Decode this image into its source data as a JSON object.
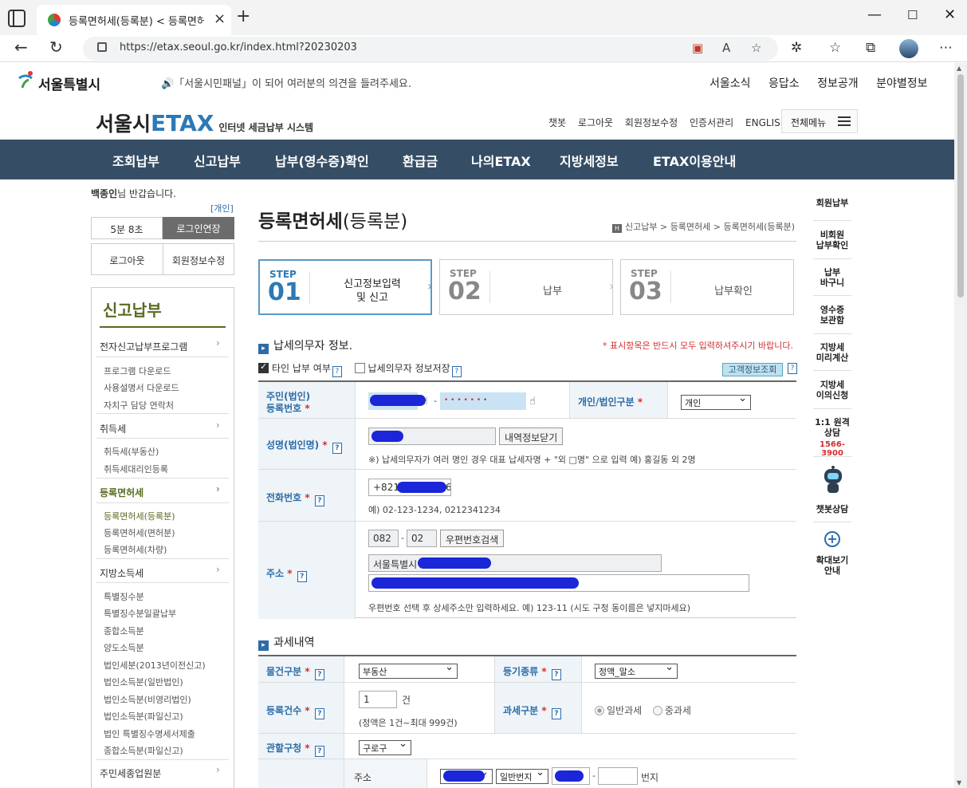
{
  "browser": {
    "tab_title": "등록면허세(등록분) < 등록면허세",
    "url": "https://etax.seoul.go.kr/index.html?20230203"
  },
  "header": {
    "seoul_name": "서울특별시",
    "notice": "🔊「서울시민패널」이 되어 여러분의 의견을 들려주세요.",
    "gnb": [
      "서울소식",
      "응답소",
      "정보공개",
      "분야별정보"
    ],
    "etax_a": "서울시",
    "etax_b": "ETAX",
    "etax_c": "인터넷 세금납부 시스템",
    "util": [
      "챗봇",
      "로그아웃",
      "회원정보수정",
      "인증서관리",
      "ENGLISH"
    ],
    "allmenu": "전체메뉴",
    "mainnav": [
      "조회납부",
      "신고납부",
      "납부(영수증)확인",
      "환급금",
      "나의ETAX",
      "지방세정보",
      "ETAX이용안내"
    ]
  },
  "left": {
    "user_name": "백종인",
    "greeting_suffix": "님 반갑습니다.",
    "user_type": "[개인]",
    "timer": "5분 8초",
    "extend": "로그인연장",
    "logout": "로그아웃",
    "member": "회원정보수정",
    "lnb_title": "신고납부",
    "cat_efile": "전자신고납부프로그램",
    "sub_efile": [
      "프로그램 다운로드",
      "사용설명서 다운로드",
      "자치구 담당 연락처"
    ],
    "cat_acq": "취득세",
    "sub_acq": [
      "취득세(부동산)",
      "취득세대리인등록"
    ],
    "cat_reg": "등록면허세",
    "sub_reg": [
      "등록면허세(등록분)",
      "등록면허세(면허분)",
      "등록면허세(차량)"
    ],
    "cat_local": "지방소득세",
    "sub_local": [
      "특별징수분",
      "특별징수분일괄납부",
      "종합소득분",
      "양도소득분",
      "법인세분(2013년이전신고)",
      "법인소득분(일반법인)",
      "법인소득분(비영리법인)",
      "법인소득분(파일신고)",
      "법인 특별징수명세서제출",
      "종합소득분(파일신고)"
    ],
    "cat_resident": "주민세종업원분"
  },
  "main": {
    "title_bold": "등록면허세",
    "title_rest": "(등록분)",
    "breadcrumb": "신고납부 > 등록면허세 > 등록면허세(등록분)",
    "steps": [
      {
        "lbl": "STEP",
        "num": "01",
        "text1": "신고정보입력",
        "text2": "및 신고"
      },
      {
        "lbl": "STEP",
        "num": "02",
        "text1": "납부"
      },
      {
        "lbl": "STEP",
        "num": "03",
        "text1": "납부확인"
      }
    ],
    "section1": "납세의무자 정보.",
    "req_note": "* 표시항목은 반드시 모두 입력하셔주시기 바랍니다.",
    "chk_other": "타인 납부 여부",
    "chk_save": "납세의무자 정보저장",
    "cust_btn": "고객정보조회",
    "rrn_label1": "주민(법인)",
    "rrn_label2": "등록번호",
    "rrn_dash": "-",
    "rrn_masked": "• • • • • • •",
    "type_label": "개인/법인구분",
    "type_value": "개인",
    "name_label": "성명(법인명)",
    "name_btn": "내역정보닫기",
    "name_hint": "※) 납세의무자가 여러 명인 경우 대표 납세자명 + \"외 □명\" 으로 입력 예) 홍길동 외 2명",
    "phone_label": "전화번호",
    "phone_prefix": "+821",
    "phone_suffix": "6",
    "phone_hint": "예) 02-123-1234, 0212341234",
    "addr_label": "주소",
    "zip1": "082",
    "zip_dash": "-",
    "zip2": "02",
    "zip_btn": "우편번호검색",
    "addr1_prefix": "서울특별시",
    "addr_hint": "우편번호 선택 후 상세주소만 입력하세요. 예) 123-11 (시도 구청 동이름은 넣지마세요)",
    "section2": "과세내역",
    "obj_label": "물건구분",
    "obj_value": "부동산",
    "reg_kind_label": "등기종류",
    "reg_kind_value": "정액_말소",
    "count_label": "등록건수",
    "count_value": "1",
    "count_unit": "건",
    "count_hint": "(정액은 1건~최대 999건)",
    "tax_type_label": "과세구분",
    "tax_general": "일반과세",
    "tax_heavy": "중과세",
    "office_label": "관할구청",
    "office_value": "구로구",
    "addr2_label": "주소",
    "lot_type": "일반번지",
    "lot_dash": "-",
    "lot_unit": "번지"
  },
  "quick": {
    "items": [
      "회원납부",
      "비회원\n납부확인",
      "납부\n바구니",
      "영수증\n보관함",
      "지방세\n미리계산",
      "지방세\n이의신청",
      "1:1 원격\n상담"
    ],
    "phone": "1566-3900",
    "chatbot": "챗봇상담",
    "zoom": "확대보기\n안내"
  }
}
